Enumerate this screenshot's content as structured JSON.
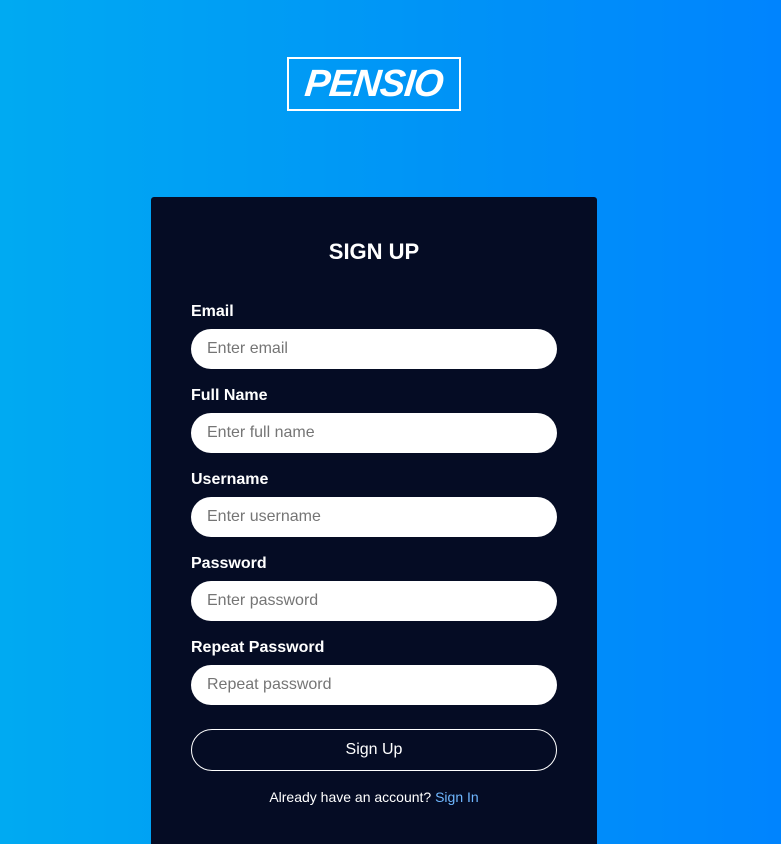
{
  "brand": {
    "logo_text": "PENSIO"
  },
  "form": {
    "title": "SIGN UP",
    "fields": [
      {
        "label": "Email",
        "placeholder": "Enter email",
        "value": ""
      },
      {
        "label": "Full Name",
        "placeholder": "Enter full name",
        "value": ""
      },
      {
        "label": "Username",
        "placeholder": "Enter username",
        "value": ""
      },
      {
        "label": "Password",
        "placeholder": "Enter password",
        "value": ""
      },
      {
        "label": "Repeat Password",
        "placeholder": "Repeat password",
        "value": ""
      }
    ],
    "submit_label": "Sign Up",
    "footer_text": "Already have an account?",
    "footer_link": "Sign In"
  },
  "colors": {
    "background_gradient_start": "#00aaf2",
    "background_gradient_end": "#0084fe",
    "card_background": "#050c24",
    "link_color": "#6fb7ff"
  }
}
